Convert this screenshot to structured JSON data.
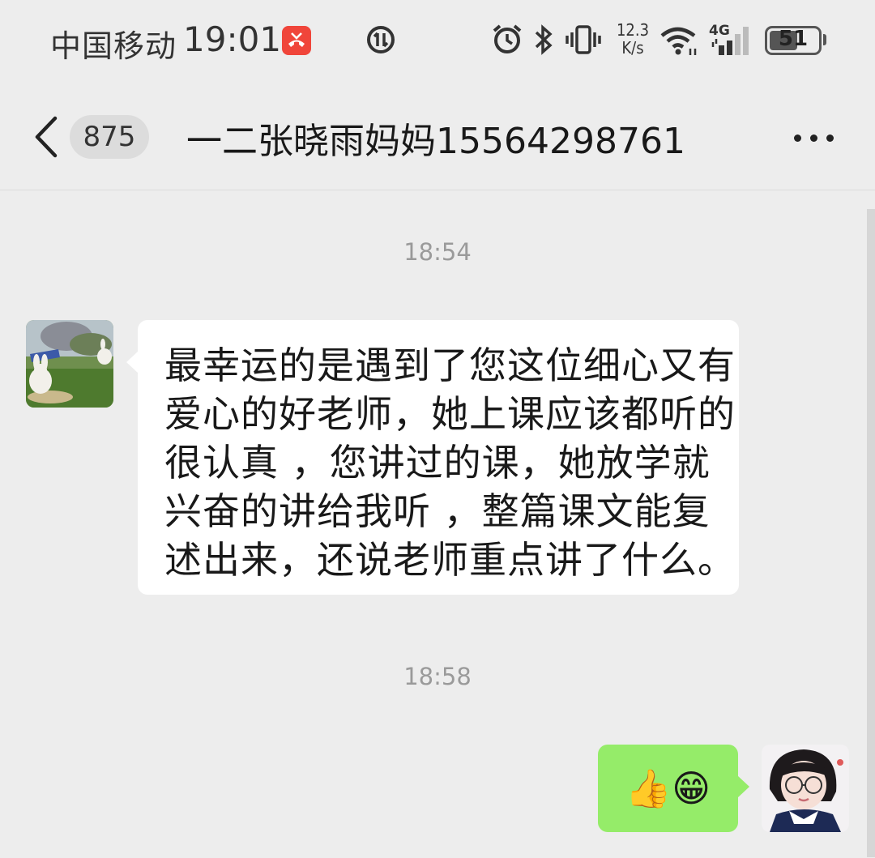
{
  "status_bar": {
    "carrier": "中国移动",
    "time": "19:01",
    "net_speed_value": "12.3",
    "net_speed_unit": "K/s",
    "network_type": "4G",
    "battery": "51",
    "icons": [
      "missed-call-icon",
      "data-saver-icon",
      "alarm-icon",
      "bluetooth-icon",
      "vibrate-icon",
      "wifi-icon",
      "signal-icon",
      "battery-icon"
    ]
  },
  "nav": {
    "unread_count": "875",
    "title": "一二张晓雨妈妈15564298761",
    "icons": [
      "back-arrow-icon",
      "more-dots-icon"
    ]
  },
  "messages": [
    {
      "type": "timestamp",
      "text": "18:54"
    },
    {
      "type": "incoming",
      "lines": [
        "最幸运的是遇到了您这位细心又有",
        "爱心的好老师，她上课应该都听的",
        "很认真 ，您讲过的课，她放学就",
        "兴奋的讲给我听 ，整篇课文能复",
        "述出来，还说老师重点讲了什么。"
      ]
    },
    {
      "type": "timestamp",
      "text": "18:58"
    },
    {
      "type": "outgoing",
      "text": "👍😁"
    }
  ],
  "colors": {
    "background": "#ededed",
    "incoming_bubble": "#ffffff",
    "outgoing_bubble": "#95ec69",
    "missed_call": "#f0453a"
  }
}
